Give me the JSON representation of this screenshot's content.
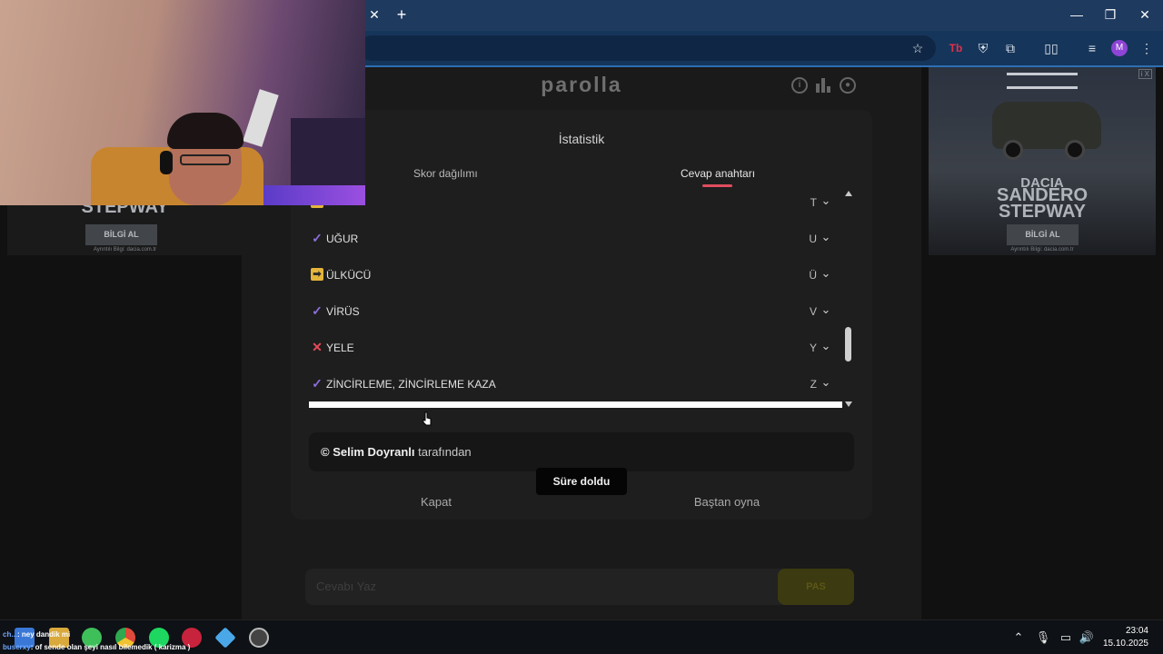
{
  "browser": {
    "tab_close": "✕",
    "new_tab": "+",
    "minimize": "—",
    "restore": "❐",
    "close": "✕",
    "profile_initial": "M"
  },
  "site": {
    "logo": "parolla",
    "guess_placeholder": "Cevabı Yaz",
    "pass_label": "PAS"
  },
  "ads": {
    "left": {
      "title": "STEPWAY",
      "button": "BİLGİ AL",
      "note": "Ayrıntılı Bilgi: dacia.com.tr"
    },
    "right": {
      "title": "SANDERO STEPWAY",
      "brand": "DACIA",
      "button": "BİLGİ AL",
      "note": "Ayrıntılı Bilgi: dacia.com.tr",
      "mark": "i X"
    }
  },
  "modal": {
    "title": "İstatistik",
    "tabs": [
      {
        "label": "Skor dağılımı",
        "active": false
      },
      {
        "label": "Cevap anahtarı",
        "active": true
      }
    ],
    "answers": [
      {
        "status": "pass",
        "word": "",
        "letter": "T"
      },
      {
        "status": "correct",
        "word": "UĞUR",
        "letter": "U"
      },
      {
        "status": "pass",
        "word": "ÜLKÜCÜ",
        "letter": "Ü"
      },
      {
        "status": "correct",
        "word": "VİRÜS",
        "letter": "V"
      },
      {
        "status": "wrong",
        "word": "YELE",
        "letter": "Y"
      },
      {
        "status": "correct",
        "word": "ZİNCİRLEME, ZİNCİRLEME KAZA",
        "letter": "Z"
      }
    ],
    "credit_name": "© Selim Doyranlı",
    "credit_suffix": " tarafından",
    "close_button": "Kapat",
    "restart_button": "Baştan oyna",
    "toast": "Süre doldu"
  },
  "taskbar": {
    "chat": [
      {
        "user": "ch...",
        "message": ": ney dandik mi"
      },
      {
        "user": "buserxy",
        "message": ": of sende olan şeyi nasıl bilemedik ( karizma )"
      }
    ],
    "time": "23:04",
    "date": "15.10.2025"
  },
  "colors": {
    "tab_underline": "#e04d5e",
    "correct": "#8b6fd8",
    "wrong": "#e64a5a",
    "pass": "#e4b53a"
  }
}
